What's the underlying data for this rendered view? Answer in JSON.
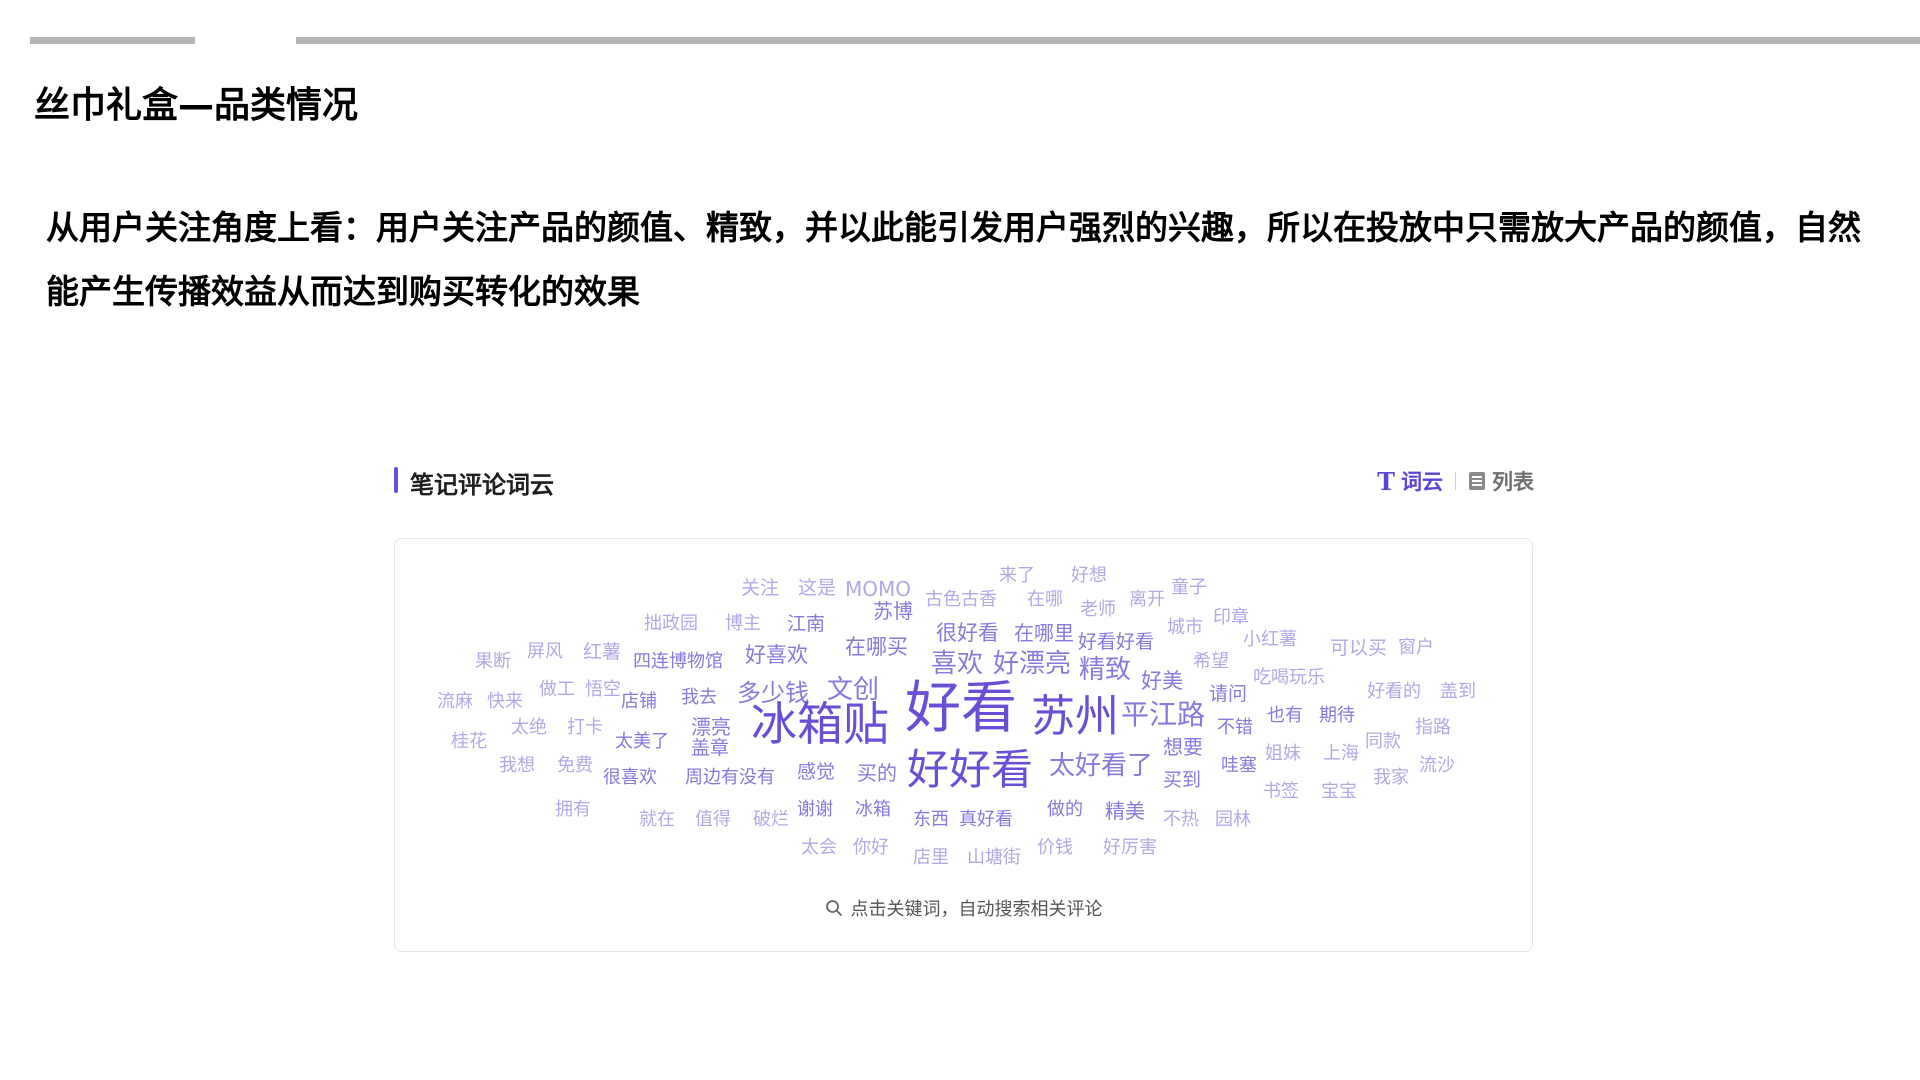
{
  "page": {
    "title": "丝巾礼盒—品类情况",
    "summary": "从用户关注角度上看：用户关注产品的颜值、精致，并以此能引发用户强烈的兴趣，所以在投放中只需放大产品的颜值，自然能产生传播效益从而达到购买转化的效果"
  },
  "panel": {
    "title": "笔记评论词云",
    "toggle": {
      "wordcloud_label": "词云",
      "list_label": "列表"
    },
    "hint": "点击关键词，自动搜索相关评论"
  },
  "colors": {
    "accent": "#6c4ee0",
    "strong": "#6a4fd6",
    "mid": "#8a78dc",
    "light": "#b3a8e6"
  },
  "wordcloud": [
    {
      "text": "关注"
    },
    {
      "text": "这是"
    },
    {
      "text": "MOMO"
    },
    {
      "text": "古色古香"
    },
    {
      "text": "来了"
    },
    {
      "text": "好想"
    },
    {
      "text": "童子"
    },
    {
      "text": "苏博"
    },
    {
      "text": "在哪"
    },
    {
      "text": "老师"
    },
    {
      "text": "离开"
    },
    {
      "text": "印章"
    },
    {
      "text": "拙政园"
    },
    {
      "text": "博主"
    },
    {
      "text": "江南"
    },
    {
      "text": "很好看"
    },
    {
      "text": "在哪里"
    },
    {
      "text": "好看好看"
    },
    {
      "text": "城市"
    },
    {
      "text": "小红薯"
    },
    {
      "text": "可以买"
    },
    {
      "text": "窗户"
    },
    {
      "text": "果断"
    },
    {
      "text": "屏风"
    },
    {
      "text": "红薯"
    },
    {
      "text": "四连博物馆"
    },
    {
      "text": "好喜欢"
    },
    {
      "text": "在哪买"
    },
    {
      "text": "喜欢"
    },
    {
      "text": "好漂亮"
    },
    {
      "text": "精致"
    },
    {
      "text": "希望"
    },
    {
      "text": "吃喝玩乐"
    },
    {
      "text": "流麻"
    },
    {
      "text": "快来"
    },
    {
      "text": "做工"
    },
    {
      "text": "悟空"
    },
    {
      "text": "店铺"
    },
    {
      "text": "我去"
    },
    {
      "text": "多少钱"
    },
    {
      "text": "文创"
    },
    {
      "text": "好美"
    },
    {
      "text": "请问"
    },
    {
      "text": "好看的"
    },
    {
      "text": "盖到"
    },
    {
      "text": "桂花"
    },
    {
      "text": "太绝"
    },
    {
      "text": "打卡"
    },
    {
      "text": "太美了"
    },
    {
      "text": "漂亮"
    },
    {
      "text": "冰箱贴"
    },
    {
      "text": "好看"
    },
    {
      "text": "苏州"
    },
    {
      "text": "平江路"
    },
    {
      "text": "不错"
    },
    {
      "text": "也有"
    },
    {
      "text": "期待"
    },
    {
      "text": "指路"
    },
    {
      "text": "同款"
    },
    {
      "text": "我想"
    },
    {
      "text": "免费"
    },
    {
      "text": "盖章"
    },
    {
      "text": "想要"
    },
    {
      "text": "姐妹"
    },
    {
      "text": "上海"
    },
    {
      "text": "流沙"
    },
    {
      "text": "很喜欢"
    },
    {
      "text": "周边有没有"
    },
    {
      "text": "感觉"
    },
    {
      "text": "买的"
    },
    {
      "text": "好好看"
    },
    {
      "text": "太好看了"
    },
    {
      "text": "买到"
    },
    {
      "text": "哇塞"
    },
    {
      "text": "我家"
    },
    {
      "text": "拥有"
    },
    {
      "text": "书签"
    },
    {
      "text": "宝宝"
    },
    {
      "text": "谢谢"
    },
    {
      "text": "冰箱"
    },
    {
      "text": "做的"
    },
    {
      "text": "精美"
    },
    {
      "text": "就在"
    },
    {
      "text": "值得"
    },
    {
      "text": "破烂"
    },
    {
      "text": "东西"
    },
    {
      "text": "真好看"
    },
    {
      "text": "不热"
    },
    {
      "text": "园林"
    },
    {
      "text": "太会"
    },
    {
      "text": "你好"
    },
    {
      "text": "店里"
    },
    {
      "text": "山塘街"
    },
    {
      "text": "价钱"
    },
    {
      "text": "好厉害"
    }
  ]
}
